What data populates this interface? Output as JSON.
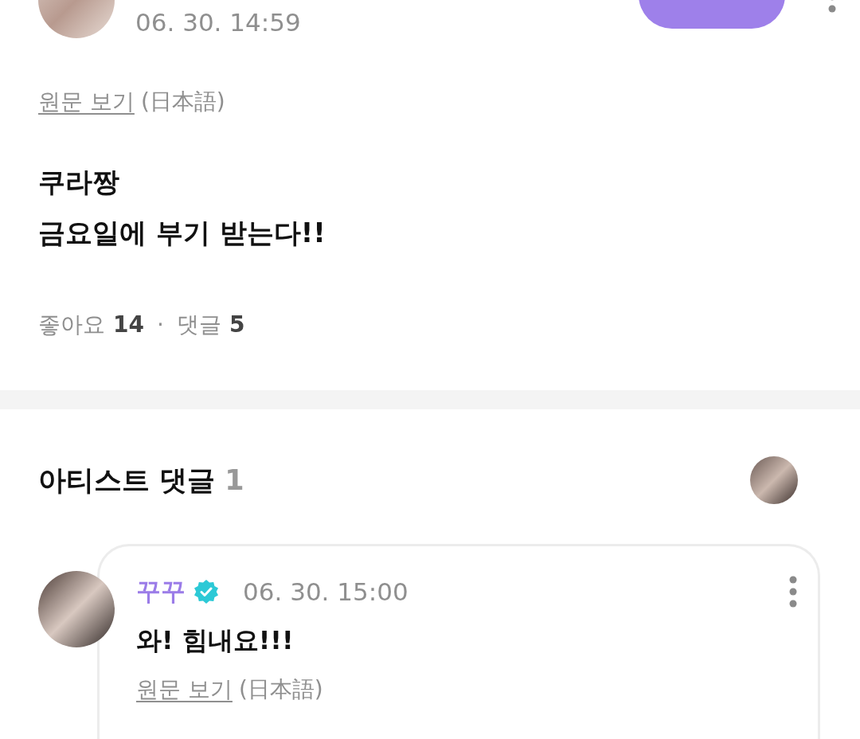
{
  "post": {
    "timestamp": "06. 30. 14:59",
    "translation": {
      "link": "원문 보기",
      "language": "(日本語)"
    },
    "body_lines": [
      "쿠라짱",
      "금요일에 부기 받는다!!"
    ],
    "stats": [
      {
        "label": "좋아요",
        "count": "14"
      },
      {
        "label": "댓글",
        "count": "5"
      }
    ],
    "stats_separator": "·"
  },
  "artist_comments": {
    "title": "아티스트 댓글",
    "count": "1",
    "comments": [
      {
        "author": "꾸꾸",
        "verified": true,
        "timestamp": "06. 30. 15:00",
        "text": "와! 힘내요!!!",
        "translation": {
          "link": "원문 보기",
          "language": "(日本語)"
        }
      }
    ]
  }
}
